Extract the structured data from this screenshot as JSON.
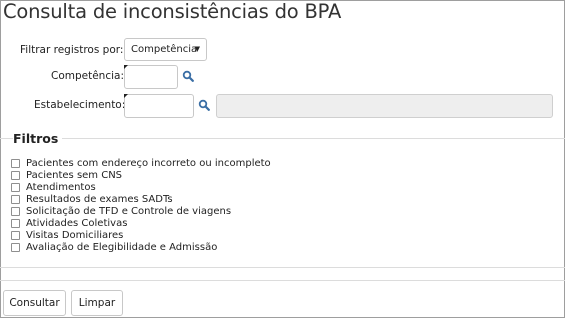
{
  "page": {
    "title": "Consulta de inconsistências do BPA"
  },
  "filter": {
    "filter_by_label": "Filtrar registros por:",
    "filter_by_value": "Competência",
    "competencia_label": "Competência:",
    "competencia_value": "",
    "estabelecimento_label": "Estabelecimento:",
    "estabelecimento_code": "",
    "estabelecimento_name": ""
  },
  "filtros": {
    "legend": "Filtros",
    "items": [
      {
        "label": "Pacientes com endereço incorreto ou incompleto",
        "checked": false
      },
      {
        "label": "Pacientes sem CNS",
        "checked": false
      },
      {
        "label": "Atendimentos",
        "checked": false
      },
      {
        "label": "Resultados de exames SADTs",
        "checked": false
      },
      {
        "label": "Solicitação de TFD e Controle de viagens",
        "checked": false
      },
      {
        "label": "Atividades Coletivas",
        "checked": false
      },
      {
        "label": "Visitas Domiciliares",
        "checked": false
      },
      {
        "label": "Avaliação de Elegibilidade e Admissão",
        "checked": false
      }
    ]
  },
  "actions": {
    "consult_label": "Consultar",
    "clear_label": "Limpar"
  },
  "colors": {
    "border": "#c8c8c8",
    "disabled_bg": "#eeeeee",
    "search_icon": "#3a6ea5"
  }
}
